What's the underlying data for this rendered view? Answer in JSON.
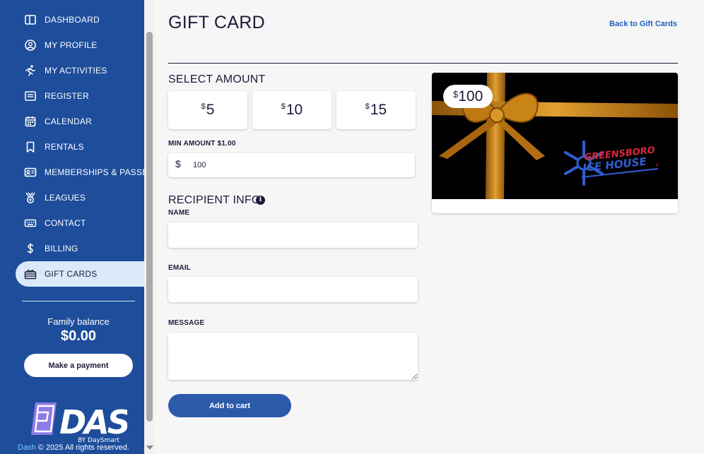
{
  "sidebar": {
    "items": [
      {
        "label": "DASHBOARD",
        "icon": "dashboard-icon"
      },
      {
        "label": "MY PROFILE",
        "icon": "profile-icon"
      },
      {
        "label": "MY ACTIVITIES",
        "icon": "activities-icon"
      },
      {
        "label": "REGISTER",
        "icon": "register-icon"
      },
      {
        "label": "CALENDAR",
        "icon": "calendar-icon"
      },
      {
        "label": "RENTALS",
        "icon": "bookmark-icon"
      },
      {
        "label": "MEMBERSHIPS & PASSES",
        "icon": "id-card-icon"
      },
      {
        "label": "LEAGUES",
        "icon": "medal-icon"
      },
      {
        "label": "CONTACT",
        "icon": "keyboard-icon"
      },
      {
        "label": "BILLING",
        "icon": "dollar-icon"
      },
      {
        "label": "GIFT CARDS",
        "icon": "gift-icon",
        "active": true
      }
    ],
    "family_balance_label": "Family balance",
    "family_balance_value": "$0.00",
    "payment_button": "Make a payment",
    "logo_text": "DASH",
    "logo_sub": "BY DaySmart",
    "copyright_brand": "Dash",
    "copyright_text": "© 2025 All rights reserved."
  },
  "page": {
    "title": "GIFT CARD",
    "back_link": "Back to Gift Cards"
  },
  "amount": {
    "section_title": "SELECT AMOUNT",
    "currency": "$",
    "options": [
      "5",
      "10",
      "15"
    ],
    "min_label": "MIN AMOUNT $1.00",
    "value": "100"
  },
  "recipient": {
    "section_title": "RECIPIENT INFO",
    "info_icon": "i",
    "name_label": "NAME",
    "name_value": "",
    "email_label": "EMAIL",
    "email_value": "",
    "message_label": "MESSAGE",
    "message_value": ""
  },
  "cart_button": "Add to cart",
  "card_preview": {
    "currency": "$",
    "amount": "100",
    "brand_line1": "GREENSBORO",
    "brand_line2": "ICE HOUSE"
  },
  "colors": {
    "sidebar": "#1e4d9b",
    "active_item": "#dbe9fb",
    "link": "#1f5fbf",
    "primary_button": "#2c5aab",
    "ribbon": "#c07a14",
    "brand_red": "#d6283a",
    "brand_blue": "#2f5fd0"
  }
}
